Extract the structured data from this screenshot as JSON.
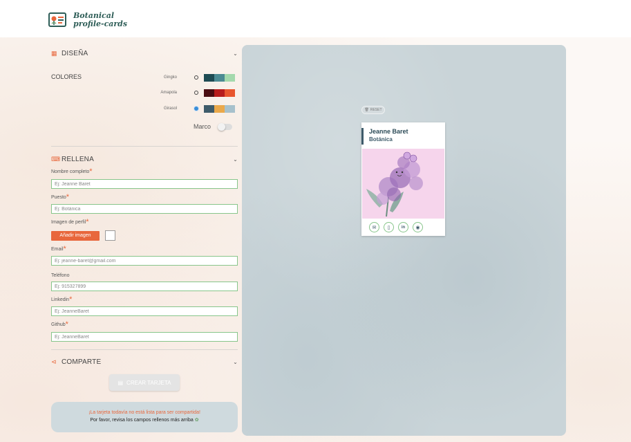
{
  "brand": {
    "line1": "Botanical",
    "line2": "profile-cards"
  },
  "design": {
    "title": "DISEÑA",
    "colors_label": "COLORES",
    "palettes": [
      {
        "name": "Gingko",
        "selected": false,
        "colors": [
          "#1e4b53",
          "#4c8b93",
          "#a4d9ad"
        ]
      },
      {
        "name": "Amapola",
        "selected": false,
        "colors": [
          "#4a0d11",
          "#b71c1c",
          "#e8562e"
        ]
      },
      {
        "name": "Girasol",
        "selected": true,
        "colors": [
          "#3e5b6a",
          "#eaa84a",
          "#a7c1cc"
        ]
      }
    ],
    "frame_label": "Marco"
  },
  "fill": {
    "title": "RELLENA",
    "fields": {
      "name": {
        "label": "Nombre completo",
        "placeholder": "Ej: Jeanne Baret"
      },
      "job": {
        "label": "Puesto",
        "placeholder": "Ej: Botánica"
      },
      "image": {
        "label": "Imagen de perfil",
        "button": "Añadir imagen"
      },
      "email": {
        "label": "Email",
        "placeholder": "Ej: jeanne-baret@gmail.com"
      },
      "phone": {
        "label": "Teléfono",
        "placeholder": "Ej: 915327899"
      },
      "linkedin": {
        "label": "Linkedin",
        "placeholder": "Ej: JeanneBaret"
      },
      "github": {
        "label": "Github",
        "placeholder": "Ej: JeanneBaret"
      }
    }
  },
  "share": {
    "title": "COMPARTE",
    "create_button": "CREAR TARJETA",
    "notice_line1": "¡La tarjeta todavía no está lista para ser compartida!",
    "notice_line2": "Por favor, revisa los campos rellenos más arriba"
  },
  "preview": {
    "reset_label": "RESET",
    "card_name": "Jeanne Baret",
    "card_job": "Botánica"
  },
  "colors": {
    "accent": "#e8673c",
    "input_border": "#87c58a",
    "card_line": "#3e5b6a"
  }
}
